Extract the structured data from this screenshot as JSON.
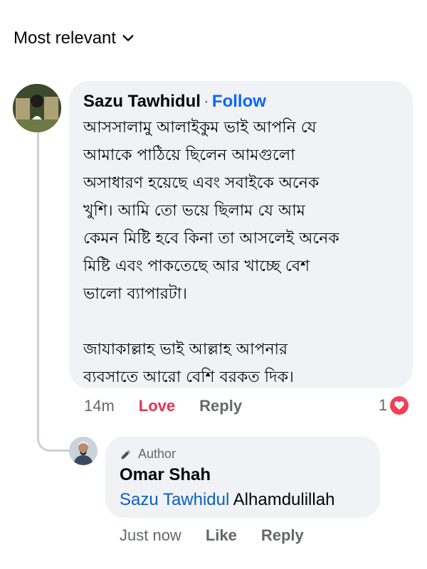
{
  "sort": {
    "label": "Most relevant"
  },
  "comment": {
    "author": "Sazu Tawhidul",
    "separator": "·",
    "follow_label": "Follow",
    "text": "আসসালামু আলাইকুম ভাই আপনি যে\nআমাকে পাঠিয়ে ছিলেন আমগুলো\nঅসাধারণ হয়েছে এবং সবাইকে অনেক\nখুশি।  আমি তো ভয়ে ছিলাম যে আম\nকেমন মিষ্টি হবে কিনা তা আসলেই অনেক\nমিষ্টি এবং পাকতেছে আর খাচ্ছে বেশ\nভালো ব্যাপারটা।\n\nজাযাকাল্লাহ ভাই আল্লাহ আপনার\nব্যবসাতে আরো বেশি বরকত দিক।",
    "time": "14m",
    "love_label": "Love",
    "reply_label": "Reply",
    "reaction_count": "1",
    "reaction_icon": "heart-icon"
  },
  "reply": {
    "badge_label": "Author",
    "badge_icon": "pencil-icon",
    "author": "Omar Shah",
    "mention": "Sazu Tawhidul",
    "text": " Alhamdulillah",
    "time": "Just now",
    "like_label": "Like",
    "reply_label": "Reply"
  }
}
